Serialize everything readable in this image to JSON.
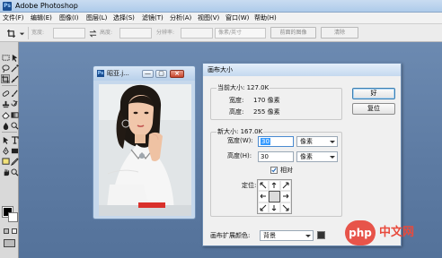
{
  "app": {
    "title": "Adobe Photoshop",
    "icon_letters": "Ps"
  },
  "menu": [
    "文件(F)",
    "编辑(E)",
    "图像(I)",
    "图层(L)",
    "选择(S)",
    "滤镜(T)",
    "分析(A)",
    "视图(V)",
    "窗口(W)",
    "帮助(H)"
  ],
  "options_bar": {
    "width_label": "宽度:",
    "height_label": "高度:",
    "resolution_label": "分辨率:",
    "unit_select": "像素/英寸",
    "front_image_button": "前面的图像",
    "clear_button": "清除"
  },
  "document": {
    "title": "昭亚.j...",
    "minimize": "—",
    "restore": "▢",
    "close": "×"
  },
  "dialog": {
    "title": "画布大小",
    "current_size": {
      "title": "当前大小: 127.0K",
      "width_label": "宽度:",
      "width_value": "170 像素",
      "height_label": "高度:",
      "height_value": "255 像素"
    },
    "new_size": {
      "title": "新大小: 167.0K",
      "width_label": "宽度(W):",
      "width_value": "30",
      "width_unit": "像素",
      "height_label": "高度(H):",
      "height_value": "30",
      "height_unit": "像素",
      "relative_label": "相对",
      "relative_checked": true,
      "anchor_label": "定位:"
    },
    "ok_button": "好",
    "reset_button": "复位",
    "canvas_color_label": "画布扩展颜色:",
    "canvas_color_value": "背景",
    "canvas_color_swatch": "#333333"
  },
  "watermark": {
    "logo": "php",
    "text": "中文网"
  }
}
